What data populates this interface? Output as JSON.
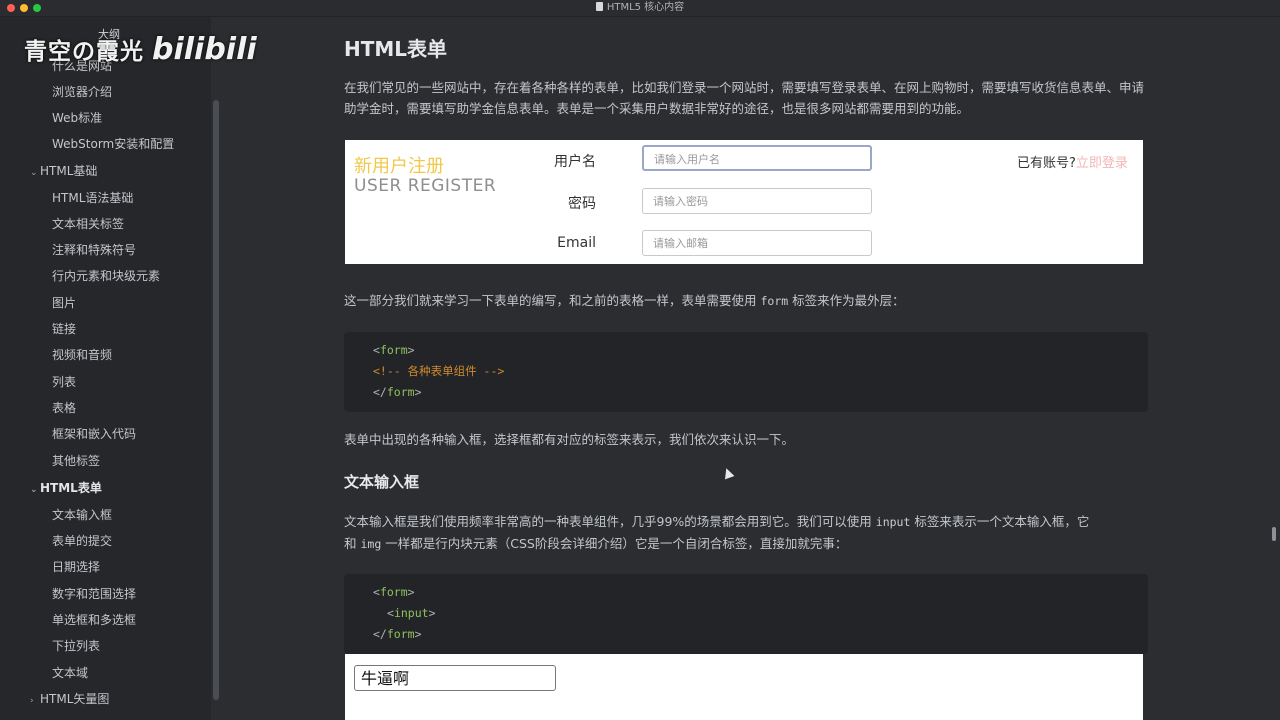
{
  "window": {
    "title": "HTML5 核心内容"
  },
  "watermark": {
    "text": "青空の霞光",
    "logo": "bilibili"
  },
  "sidebar": {
    "outline_label": "大纲",
    "items_top": [
      "什么是网站",
      "浏览器介绍",
      "Web标准",
      "WebStorm安装和配置"
    ],
    "section_basics": "HTML基础",
    "items_basics": [
      "HTML语法基础",
      "文本相关标签",
      "注释和特殊符号",
      "行内元素和块级元素",
      "图片",
      "链接",
      "视频和音频",
      "列表",
      "表格",
      "框架和嵌入代码",
      "其他标签"
    ],
    "section_forms": "HTML表单",
    "items_forms": [
      "文本输入框",
      "表单的提交",
      "日期选择",
      "数字和范围选择",
      "单选框和多选框",
      "下拉列表",
      "文本域"
    ],
    "section_svg": "HTML矢量图"
  },
  "main": {
    "title": "HTML表单",
    "intro": "在我们常见的一些网站中，存在着各种各样的表单，比如我们登录一个网站时，需要填写登录表单、在网上购物时，需要填写收货信息表单、申请助学金时，需要填写助学金信息表单。表单是一个采集用户数据非常好的途径，也是很多网站都需要用到的功能。",
    "register_demo": {
      "title_cn": "新用户注册",
      "title_en": "USER REGISTER",
      "username_label": "用户名",
      "username_placeholder": "请输入用户名",
      "password_label": "密码",
      "password_placeholder": "请输入密码",
      "email_label": "Email",
      "email_placeholder": "请输入邮箱",
      "have_account": "已有账号?",
      "login_link": "立即登录"
    },
    "para2_before": "这一部分我们就来学习一下表单的编写，和之前的表格一样，表单需要使用 ",
    "para2_code": "form",
    "para2_after": " 标签来作为最外层：",
    "code1": {
      "open": "form",
      "comment": "<!-- 各种表单组件 -->",
      "close": "form"
    },
    "para3": "表单中出现的各种输入框，选择框都有对应的标签来表示，我们依次来认识一下。",
    "h2": "文本输入框",
    "para4_a": "文本输入框是我们使用频率非常高的一种表单组件，几乎99%的场景都会用到它。我们可以使用 ",
    "para4_code1": "input",
    "para4_b": " 标签来表示一个文本输入框，它",
    "para4_c": "和 ",
    "para4_code2": "img",
    "para4_d": " 一样都是行内块元素（CSS阶段会详细介绍）它是一个自闭合标签，直接加就完事：",
    "code2": {
      "open": "form",
      "inner": "input",
      "close": "form"
    },
    "demo_input_value": "牛逼啊"
  }
}
